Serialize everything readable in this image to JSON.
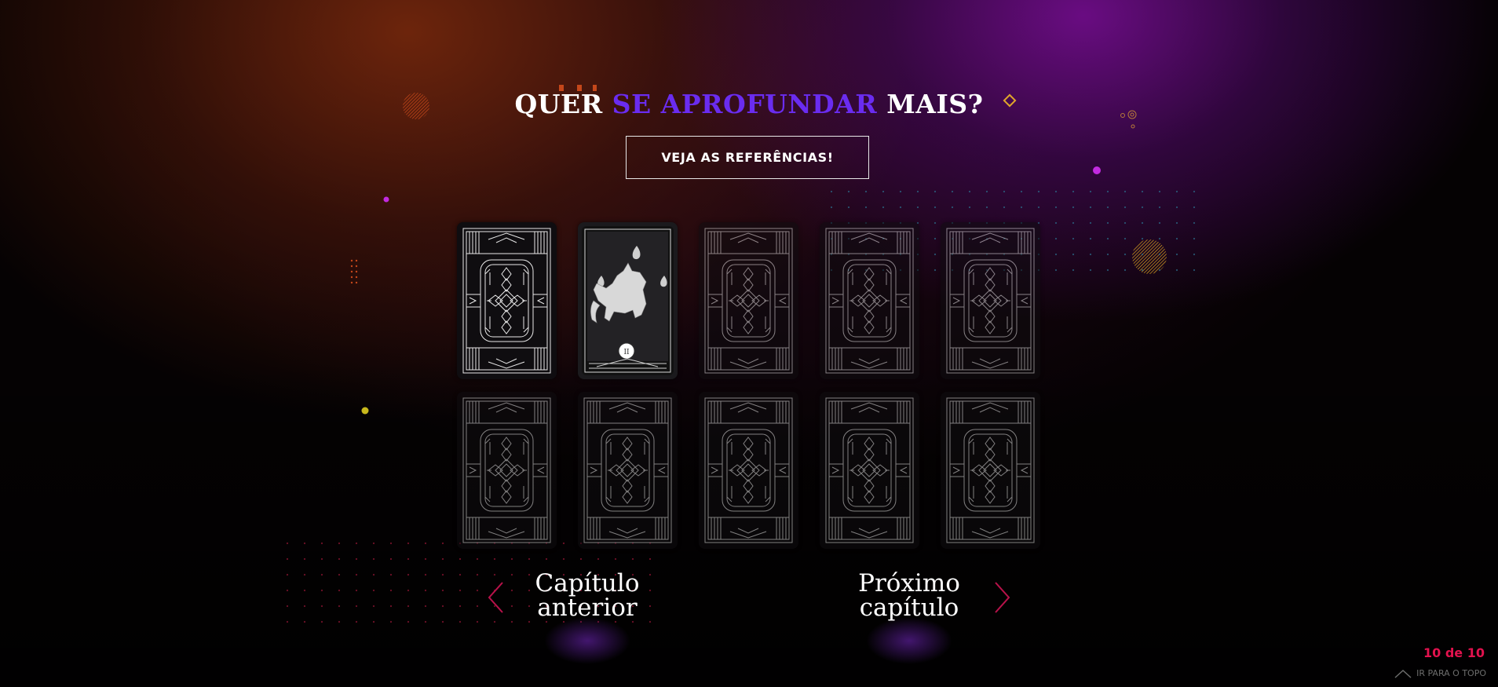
{
  "header": {
    "title_pre": "QUER ",
    "title_accent": "SE APROFUNDAR",
    "title_post": " MAIS?",
    "accent_color": "#6a2cf0"
  },
  "references_button": {
    "label": "VEJA AS REFERÊNCIAS!"
  },
  "cards": [
    {
      "state": "back",
      "active": true
    },
    {
      "state": "revealed",
      "image": "fox-spirit-card",
      "badge": "II"
    },
    {
      "state": "back",
      "active": false
    },
    {
      "state": "back",
      "active": false
    },
    {
      "state": "back",
      "active": false
    },
    {
      "state": "back",
      "active": false
    },
    {
      "state": "back",
      "active": false
    },
    {
      "state": "back",
      "active": false
    },
    {
      "state": "back",
      "active": false
    },
    {
      "state": "back",
      "active": false
    }
  ],
  "navigation": {
    "prev_line1": "Capítulo",
    "prev_line2": "anterior",
    "next_line1": "Próximo",
    "next_line2": "capítulo",
    "prev_icon": "chevron-left-icon",
    "next_icon": "chevron-right-icon",
    "chevron_color": "#b8124a"
  },
  "pagination": {
    "current": "10 de 10",
    "color": "#e2124e"
  },
  "back_to_top": {
    "label": "IR PARA O TOPO",
    "icon": "chevron-up-icon"
  }
}
